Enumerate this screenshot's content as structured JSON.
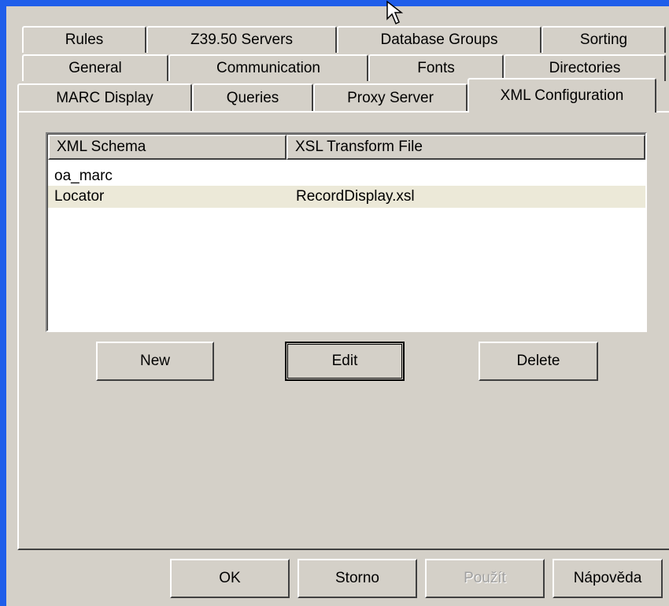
{
  "tabs": {
    "row1": [
      "Rules",
      "Z39.50 Servers",
      "Database Groups",
      "Sorting"
    ],
    "row2": [
      "General",
      "Communication",
      "Fonts",
      "Directories"
    ],
    "row3": [
      "MARC Display",
      "Queries",
      "Proxy Server",
      "XML Configuration"
    ],
    "active": "XML Configuration"
  },
  "list": {
    "columns": [
      "XML Schema",
      "XSL Transform File"
    ],
    "rows": [
      {
        "schema": "oa_marc",
        "xsl": ""
      },
      {
        "schema": "Locator",
        "xsl": "RecordDisplay.xsl"
      }
    ]
  },
  "buttons": {
    "new": "New",
    "edit": "Edit",
    "delete": "Delete"
  },
  "footer": {
    "ok": "OK",
    "cancel": "Storno",
    "apply": "Použít",
    "help": "Nápověda"
  }
}
